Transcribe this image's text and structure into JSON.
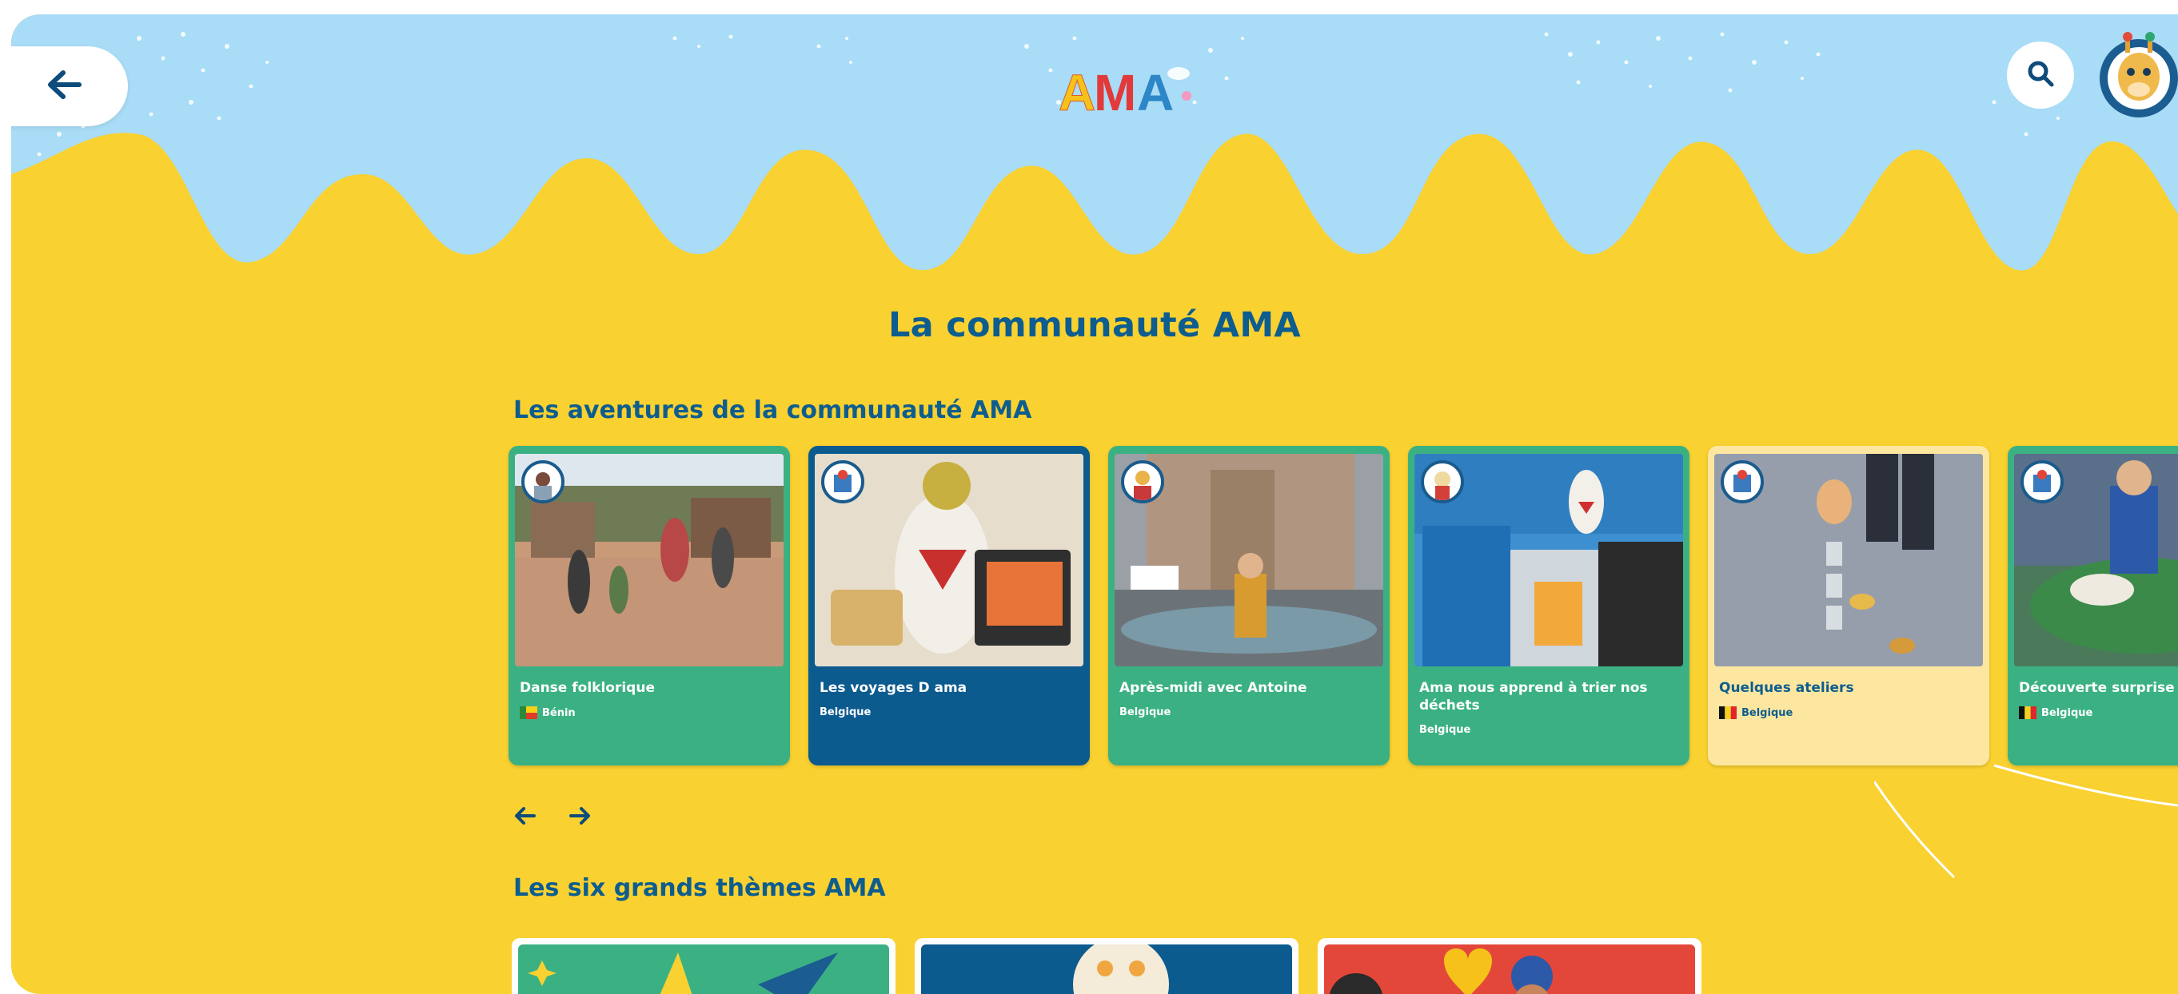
{
  "header": {
    "logo_text": "AMA",
    "back_icon": "arrow-left-icon",
    "search_icon": "search-icon",
    "avatar_icon": "giraffe-avatar-icon"
  },
  "page_title": "La communauté AMA",
  "adventures": {
    "title": "Les aventures de la communauté AMA",
    "cards": [
      {
        "title": "Danse folklorique",
        "country": "Bénin",
        "flag": "benin",
        "color": "green"
      },
      {
        "title": "Les voyages D ama",
        "country": "Belgique",
        "flag": "",
        "color": "blue"
      },
      {
        "title": "Après-midi avec Antoine",
        "country": "Belgique",
        "flag": "",
        "color": "green"
      },
      {
        "title": "Ama nous apprend à trier nos déchets",
        "country": "Belgique",
        "flag": "",
        "color": "green"
      },
      {
        "title": "Quelques ateliers",
        "country": "Belgique",
        "flag": "belgium",
        "color": "cream"
      },
      {
        "title": "Découverte surprise du",
        "country": "Belgique",
        "flag": "belgium",
        "color": "green"
      }
    ],
    "prev_icon": "arrow-left-icon",
    "next_icon": "arrow-right-icon"
  },
  "themes": {
    "title": "Les six grands thèmes AMA"
  },
  "colors": {
    "sky": "#a9dcf6",
    "yellow": "#f9d130",
    "navy": "#0d5d8f",
    "green": "#3bb183",
    "blue_card": "#0c5b8f",
    "cream_card": "#fde7a0"
  }
}
